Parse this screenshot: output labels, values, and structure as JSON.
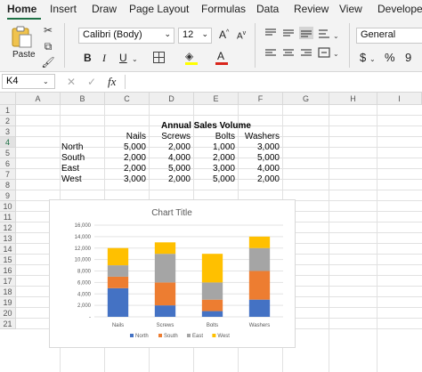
{
  "ribbon_tabs": [
    "Home",
    "Insert",
    "Draw",
    "Page Layout",
    "Formulas",
    "Data",
    "Review",
    "View",
    "Developer"
  ],
  "active_tab": "Home",
  "ribbon": {
    "paste_label": "Paste",
    "font_name": "Calibri (Body)",
    "font_size": "12",
    "number_format": "General",
    "bold": "B",
    "italic": "I",
    "underline": "U",
    "currency": "$",
    "percent": "%",
    "font_color_letter": "A",
    "grow_font": "A",
    "shrink_font": "A",
    "accent_color": "#1e7145",
    "font_color_bar": "#d9261c",
    "highlight_color_bar": "#ffff00"
  },
  "formula_bar": {
    "name_box": "K4",
    "fx": "fx",
    "formula": ""
  },
  "columns": [
    "A",
    "B",
    "C",
    "D",
    "E",
    "F",
    "G",
    "H",
    "I"
  ],
  "rows": [
    "1",
    "2",
    "3",
    "4",
    "5",
    "6",
    "7",
    "8",
    "9",
    "10",
    "11",
    "12",
    "13",
    "14",
    "15",
    "16",
    "17",
    "18",
    "19",
    "20",
    "21"
  ],
  "sheet": {
    "title": "Annual Sales Volume",
    "headers": [
      "Nails",
      "Screws",
      "Bolts",
      "Washers"
    ],
    "table": [
      {
        "region": "North",
        "values": [
          "5,000",
          "2,000",
          "1,000",
          "3,000"
        ]
      },
      {
        "region": "South",
        "values": [
          "2,000",
          "4,000",
          "2,000",
          "5,000"
        ]
      },
      {
        "region": "East",
        "values": [
          "2,000",
          "5,000",
          "3,000",
          "4,000"
        ]
      },
      {
        "region": "West",
        "values": [
          "3,000",
          "2,000",
          "5,000",
          "2,000"
        ]
      }
    ]
  },
  "chart_data": {
    "type": "bar",
    "stacked": true,
    "title": "Chart Title",
    "categories": [
      "Nails",
      "Screws",
      "Bolts",
      "Washers"
    ],
    "series": [
      {
        "name": "North",
        "values": [
          5000,
          2000,
          1000,
          3000
        ],
        "color": "#4472c4"
      },
      {
        "name": "South",
        "values": [
          2000,
          4000,
          2000,
          5000
        ],
        "color": "#ed7d31"
      },
      {
        "name": "East",
        "values": [
          2000,
          5000,
          3000,
          4000
        ],
        "color": "#a5a5a5"
      },
      {
        "name": "West",
        "values": [
          3000,
          2000,
          5000,
          2000
        ],
        "color": "#ffc000"
      }
    ],
    "ylim": [
      0,
      16000
    ],
    "yticks": [
      "-",
      "2,000",
      "4,000",
      "6,000",
      "8,000",
      "10,000",
      "12,000",
      "14,000",
      "16,000"
    ],
    "grid": true,
    "legend": "bottom"
  }
}
